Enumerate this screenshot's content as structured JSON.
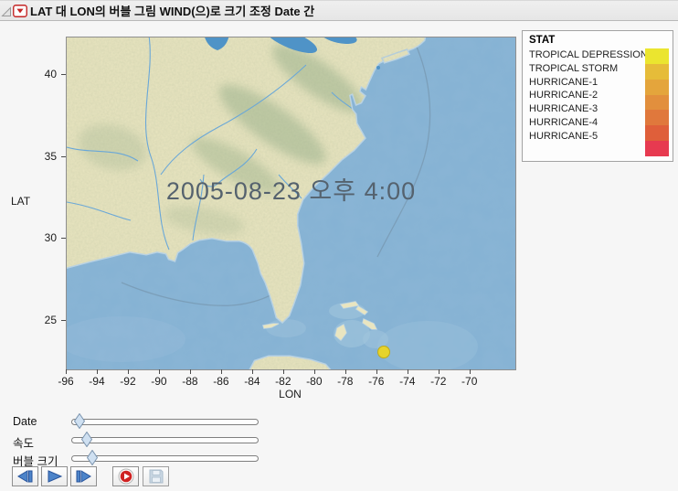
{
  "window": {
    "title": "LAT 대 LON의 버블 그림 WIND(으)로 크기 조정 Date 간"
  },
  "legend": {
    "title": "STAT",
    "items": [
      {
        "label": "TROPICAL DEPRESSION",
        "color": "#ebe52f"
      },
      {
        "label": "TROPICAL STORM",
        "color": "#e6bc39"
      },
      {
        "label": "HURRICANE-1",
        "color": "#e4a53c"
      },
      {
        "label": "HURRICANE-2",
        "color": "#e28f3d"
      },
      {
        "label": "HURRICANE-3",
        "color": "#e0783c"
      },
      {
        "label": "HURRICANE-4",
        "color": "#df5f3a"
      },
      {
        "label": "HURRICANE-5",
        "color": "#e73a50"
      }
    ]
  },
  "chart_data": {
    "type": "scatter",
    "subtype": "animated-bubble-map",
    "title": "LAT 대 LON의 버블 그림 WIND(으)로 크기 조정 Date 간",
    "xlabel": "LON",
    "ylabel": "LAT",
    "xlim": [
      -96,
      -67.1
    ],
    "ylim": [
      22.05,
      42.3
    ],
    "x_ticks": [
      -96,
      -94,
      -92,
      -90,
      -88,
      -86,
      -84,
      -82,
      -80,
      -78,
      -76,
      -74,
      -72,
      -70
    ],
    "y_ticks": [
      25,
      30,
      35,
      40
    ],
    "grid": false,
    "legend_position": "top-right",
    "time_label": "2005-08-23 오후 4:00",
    "size_by": "WIND",
    "color_by": "STAT",
    "bubbles": [
      {
        "lon": -75.6,
        "lat": 23.1,
        "stat": "TROPICAL DEPRESSION",
        "color": "#e7d42c",
        "radius_px": 7
      }
    ]
  },
  "sliders": [
    {
      "label": "Date",
      "value_pct": 2
    },
    {
      "label": "속도",
      "value_pct": 6
    },
    {
      "label": "버블 크기",
      "value_pct": 9
    }
  ],
  "controls": {
    "buttons": [
      {
        "name": "step-backward",
        "disabled": false
      },
      {
        "name": "play",
        "disabled": false
      },
      {
        "name": "step-forward",
        "disabled": false
      },
      {
        "name": "record",
        "disabled": false
      },
      {
        "name": "save",
        "disabled": true
      }
    ]
  }
}
